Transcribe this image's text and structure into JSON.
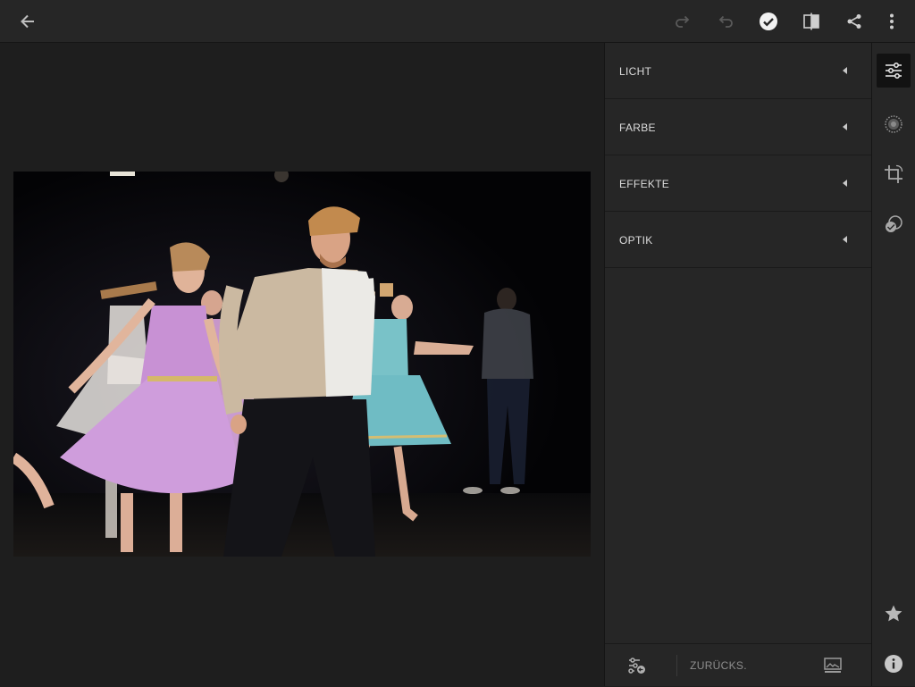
{
  "toolbar": {
    "back_icon": "arrow-left-icon",
    "redo_icon": "redo-icon",
    "undo_icon": "undo-icon",
    "done_icon": "checkmark-circle-icon",
    "compare_icon": "before-after-icon",
    "share_icon": "share-icon",
    "more_icon": "more-vertical-icon"
  },
  "edit_panel": {
    "sections": [
      {
        "label": "LICHT"
      },
      {
        "label": "FARBE"
      },
      {
        "label": "EFFEKTE"
      },
      {
        "label": "OPTIK"
      }
    ],
    "reset_label": "ZURÜCKS.",
    "presets_icon": "sliders-reset-icon",
    "before_after_icon": "image-compare-icon"
  },
  "tool_rail": {
    "tools": [
      "edit-sliders-icon",
      "radial-gradient-icon",
      "crop-icon",
      "healing-icon"
    ],
    "active_tool": "edit-sliders-icon",
    "rating_icon": "star-icon",
    "info_icon": "info-icon"
  },
  "colors": {
    "background": "#1e1e1e",
    "panel": "#262626",
    "text": "#dcdcdc",
    "icon": "#cfcfcf",
    "icon_disabled": "#5a5a5a"
  }
}
